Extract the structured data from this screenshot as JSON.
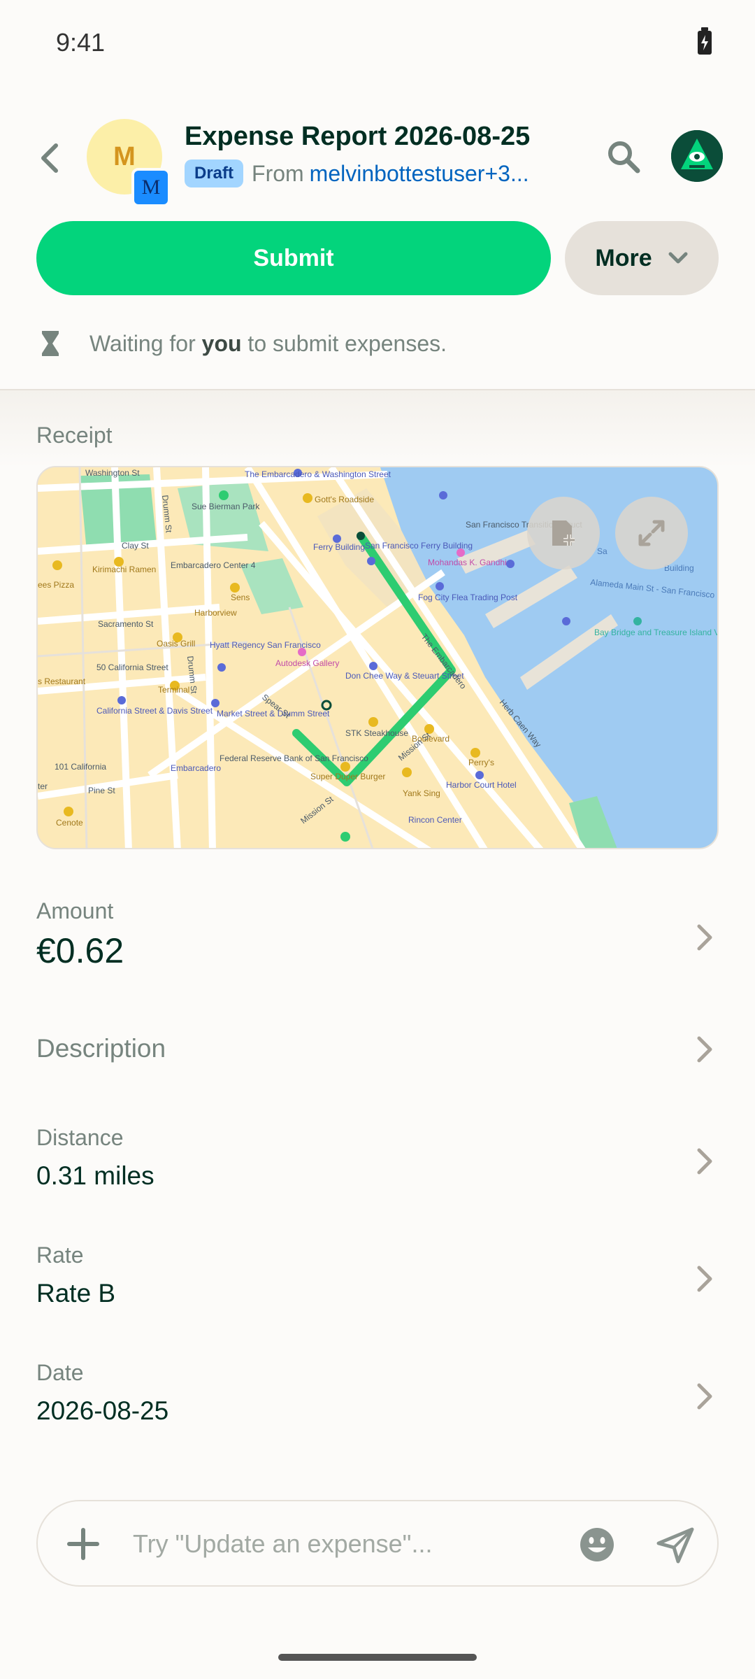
{
  "status_bar": {
    "time": "9:41"
  },
  "header": {
    "title": "Expense Report 2026-08-25",
    "badge": "Draft",
    "from_label": "From",
    "from_user": "melvinbottestuser+3...",
    "avatar_letter": "M",
    "sub_avatar_letter": "M"
  },
  "actions": {
    "submit_label": "Submit",
    "more_label": "More"
  },
  "status_message": {
    "prefix": "Waiting for",
    "emphasis": "you",
    "suffix": "to submit expenses."
  },
  "receipt": {
    "label": "Receipt",
    "map_labels": {
      "washington_st": "Washington St",
      "embarcadero_washington": "The Embarcadero & Washington Street",
      "sue_bierman": "Sue Bierman Park",
      "gotts": "Gott's Roadside",
      "sf_ferry": "San Francisco Ferry Building",
      "sf_ferry_terminal": "San Francisco Transition Struct",
      "ferry_building": "Ferry Building",
      "mahatma": "Mohandas K. Gandhi",
      "clay_st": "Clay St",
      "kirimachi": "Kirimachi Ramen",
      "embarcadero_center_4": "Embarcadero Center 4",
      "sens": "Sens",
      "harborview": "Harborview",
      "fog_city": "Fog City Flea Trading Post",
      "bay_bridge": "Bay Bridge and Treasure Island Viewpoint",
      "sacramento_st": "Sacramento St",
      "oasis_grill": "Oasis Grill",
      "hyatt": "Hyatt Regency San Francisco",
      "drumm_st": "Drumm St",
      "fifty_california": "50 California Street",
      "autodesk": "Autodesk Gallery",
      "don_chee": "Don Chee Way & Steuart Street",
      "terminal": "Terminal",
      "california_davis": "California Street & Davis Street",
      "market_drumm": "Market Street & Drumm Street",
      "spear_st": "Spear St",
      "stk": "STK Steakhouse",
      "boulevard": "Boulevard",
      "herb_caen": "Herb Caen Way",
      "one_o_one_california": "101 California",
      "embarcadero": "Embarcadero",
      "federal_reserve": "Federal Reserve Bank of San Francisco",
      "super_duper": "Super Duper Burger",
      "perrys": "Perry's",
      "pine_st": "Pine St",
      "yank_sing": "Yank Sing",
      "harbor_court": "Harbor Court Hotel",
      "mission_st": "Mission St",
      "rincon": "Rincon Center",
      "cenote": "Cenote",
      "ees_pizza": "ees Pizza",
      "restaurant": "s Restaurant",
      "the_embarcadero": "The Embarcadero",
      "mission_st_2": "Mission St",
      "alameda_main": "Alameda Main St - San Francisco Ferry",
      "building": "Building",
      "sa": "Sa",
      "ter": "ter"
    }
  },
  "fields": [
    {
      "label": "Amount",
      "value": "€0.62"
    },
    {
      "label": "Description",
      "value": ""
    },
    {
      "label": "Distance",
      "value": "0.31 miles"
    },
    {
      "label": "Rate",
      "value": "Rate B"
    },
    {
      "label": "Date",
      "value": "2026-08-25"
    }
  ],
  "composer": {
    "placeholder": "Try \"Update an expense\"..."
  },
  "colors": {
    "primary": "#03D47C",
    "text": "#002E22",
    "muted": "#76847E",
    "link": "#0164BF",
    "badge_bg": "#A2D5FF",
    "route": "#2ECC71",
    "water": "#9FCBF2"
  }
}
